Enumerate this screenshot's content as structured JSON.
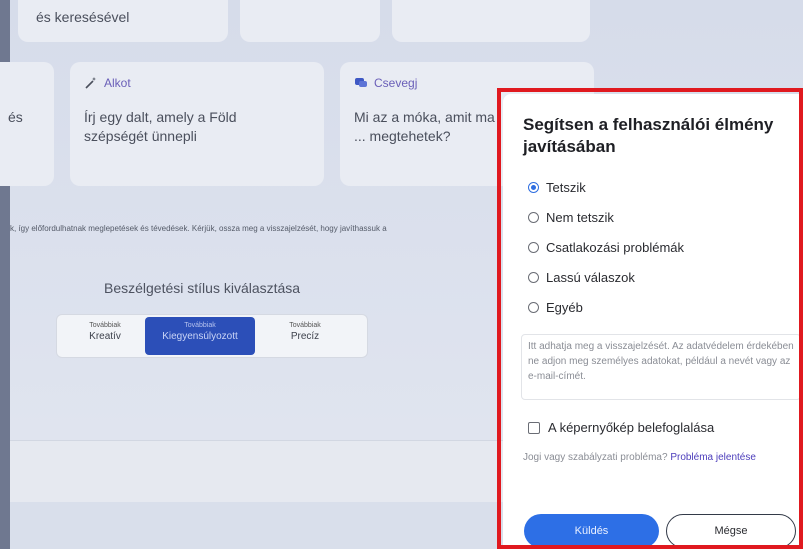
{
  "cards": {
    "top_left_text": "és keresésével",
    "left_partial_text": "és",
    "create": {
      "label": "Alkot",
      "text": "Írj egy dalt, amely a Föld szépségét ünnepli"
    },
    "chat": {
      "label": "Csevegj",
      "text": "Mi az a móka, amit ma ... megtehetek?"
    }
  },
  "disclaimer": "k, így előfordulhatnak meglepetések és tévedések. Kérjük, ossza meg a visszajelzését, hogy javíthassuk a",
  "style_picker": {
    "title": "Beszélgetési stílus kiválasztása",
    "options": [
      {
        "small": "Továbbiak",
        "main": "Kreatív"
      },
      {
        "small": "Továbbiak",
        "main": "Kiegyensúlyozott"
      },
      {
        "small": "Továbbiak",
        "main": "Precíz"
      }
    ],
    "selected": "Kiegyensúlyozott"
  },
  "feedback_panel": {
    "title": "Segítsen a felhasználói élmény javításában",
    "options": [
      "Tetszik",
      "Nem tetszik",
      "Csatlakozási problémák",
      "Lassú válaszok",
      "Egyéb"
    ],
    "selected": "Tetszik",
    "textarea_placeholder": "Itt adhatja meg a visszajelzését. Az adatvédelem érdekében ne adjon meg személyes adatokat, például a nevét vagy az e-mail-címét.",
    "screenshot_label": "A képernyőkép belefoglalása",
    "legal_text": "Jogi vagy szabályzati probléma?",
    "legal_link": "Probléma jelentése",
    "send_label": "Küldés",
    "cancel_label": "Mégse",
    "accent_color": "#2d6fe6",
    "highlight_color": "#e0191f"
  }
}
